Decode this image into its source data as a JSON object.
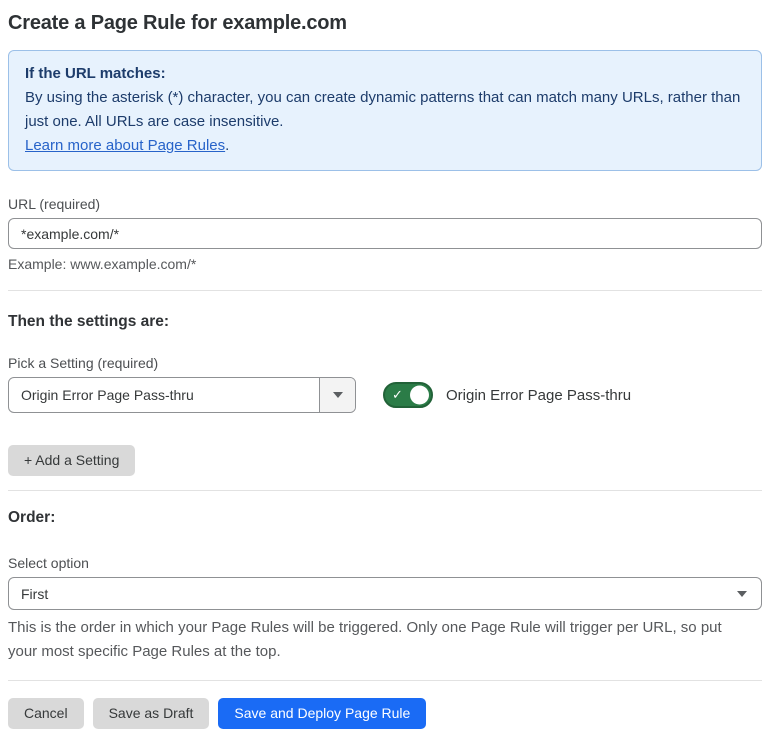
{
  "page": {
    "title": "Create a Page Rule for example.com"
  },
  "info_box": {
    "heading": "If the URL matches:",
    "body": "By using the asterisk (*) character, you can create dynamic patterns that can match many URLs, rather than just one. All URLs are case insensitive.",
    "link_label": "Learn more about Page Rules",
    "link_suffix": "."
  },
  "url_field": {
    "label": "URL (required)",
    "value": "*example.com/*",
    "hint": "Example: www.example.com/*"
  },
  "settings_section": {
    "heading": "Then the settings are:",
    "picker_label": "Pick a Setting (required)",
    "picker_value": "Origin Error Page Pass-thru",
    "toggle_label": "Origin Error Page Pass-thru",
    "toggle_state": "on",
    "toggle_check_glyph": "✓",
    "add_setting_label": "+ Add a Setting"
  },
  "order_section": {
    "heading": "Order:",
    "select_label": "Select option",
    "select_value": "First",
    "help_text": "This is the order in which your Page Rules will be triggered. Only one Page Rule will trigger per URL, so put your most specific Page Rules at the top."
  },
  "footer": {
    "cancel_label": "Cancel",
    "save_draft_label": "Save as Draft",
    "save_deploy_label": "Save and Deploy Page Rule"
  },
  "colors": {
    "info_background": "#e7f2fd",
    "info_border": "#9cc0e8",
    "info_text": "#1d3c6b",
    "link_blue": "#2763c9",
    "toggle_green": "#2b7c47",
    "toggle_green_border": "#226238",
    "primary_button_blue": "#1a6bf5",
    "gray_button": "#d9d9d9",
    "body_text": "#36393a",
    "muted_text": "#56585b"
  }
}
